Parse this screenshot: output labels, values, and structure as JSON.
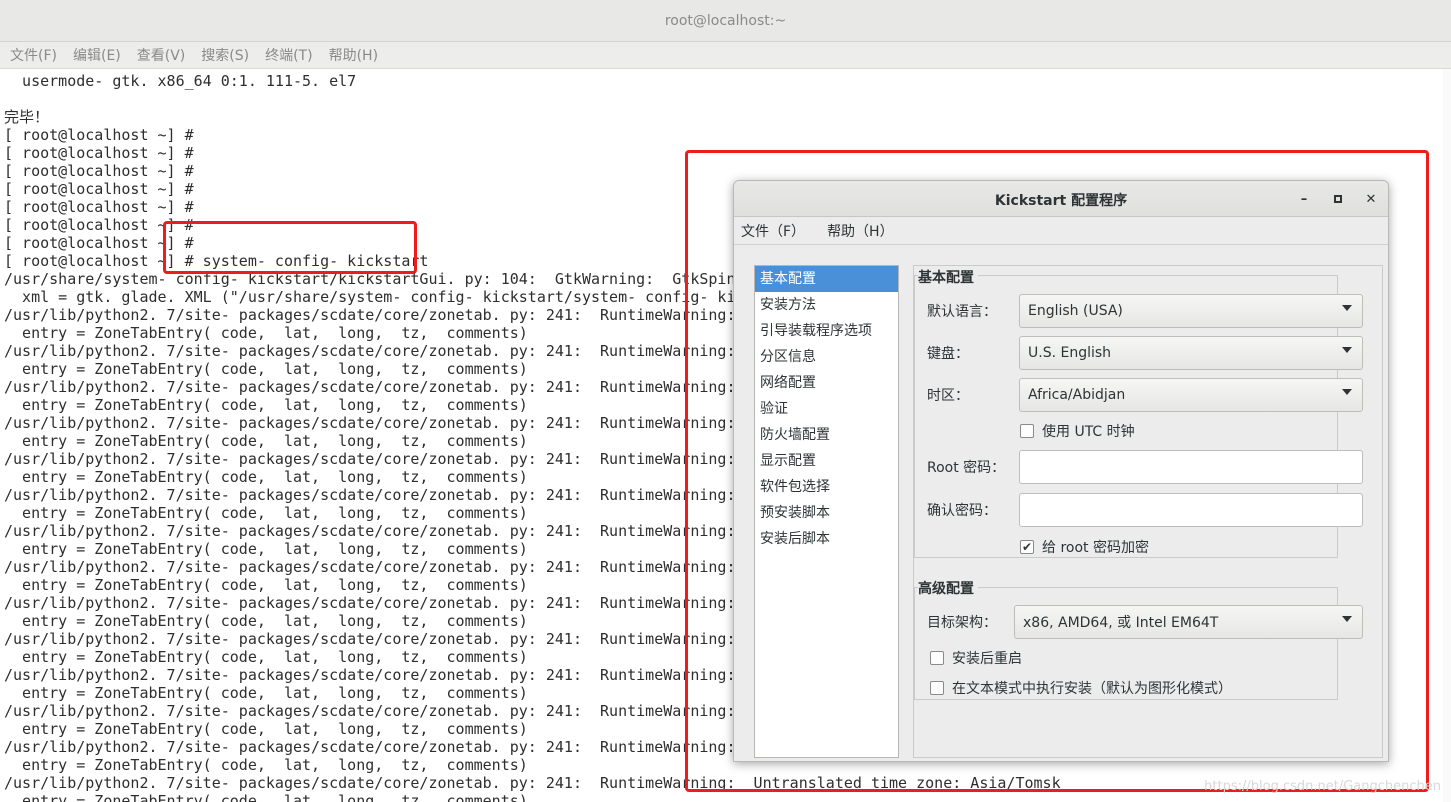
{
  "terminal": {
    "title": "root@localhost:~",
    "menu": [
      "文件(F)",
      "编辑(E)",
      "查看(V)",
      "搜索(S)",
      "终端(T)",
      "帮助(H)"
    ],
    "lines": [
      "  usermode- gtk. x86_64 0:1. 111-5. el7",
      "",
      "完毕！",
      "[ root@localhost ~] #",
      "[ root@localhost ~] #",
      "[ root@localhost ~] #",
      "[ root@localhost ~] #",
      "[ root@localhost ~] #",
      "[ root@localhost ~] #",
      "[ root@localhost ~] #",
      "[ root@localhost ~] # system- config- kickstart",
      "/usr/share/system- config- kickstart/kickstartGui. py: 104:  GtkWarning:  GtkSpinButton",
      "  xml = gtk. glade. XML (\"/usr/share/system- config- kickstart/system- config- kickstar",
      "/usr/lib/python2. 7/site- packages/scdate/core/zonetab. py: 241:  RuntimeWarning:  Untr",
      "  entry = ZoneTabEntry( code,  lat,  long,  tz,  comments)",
      "/usr/lib/python2. 7/site- packages/scdate/core/zonetab. py: 241:  RuntimeWarning:  Untr",
      "  entry = ZoneTabEntry( code,  lat,  long,  tz,  comments)",
      "/usr/lib/python2. 7/site- packages/scdate/core/zonetab. py: 241:  RuntimeWarning:  Untr",
      "  entry = ZoneTabEntry( code,  lat,  long,  tz,  comments)",
      "/usr/lib/python2. 7/site- packages/scdate/core/zonetab. py: 241:  RuntimeWarning:  Untr",
      "  entry = ZoneTabEntry( code,  lat,  long,  tz,  comments)",
      "/usr/lib/python2. 7/site- packages/scdate/core/zonetab. py: 241:  RuntimeWarning:  Untr",
      "  entry = ZoneTabEntry( code,  lat,  long,  tz,  comments)",
      "/usr/lib/python2. 7/site- packages/scdate/core/zonetab. py: 241:  RuntimeWarning:  Untr",
      "  entry = ZoneTabEntry( code,  lat,  long,  tz,  comments)",
      "/usr/lib/python2. 7/site- packages/scdate/core/zonetab. py: 241:  RuntimeWarning:  Untr",
      "  entry = ZoneTabEntry( code,  lat,  long,  tz,  comments)",
      "/usr/lib/python2. 7/site- packages/scdate/core/zonetab. py: 241:  RuntimeWarning:  Untr",
      "  entry = ZoneTabEntry( code,  lat,  long,  tz,  comments)",
      "/usr/lib/python2. 7/site- packages/scdate/core/zonetab. py: 241:  RuntimeWarning:  Untr",
      "  entry = ZoneTabEntry( code,  lat,  long,  tz,  comments)",
      "/usr/lib/python2. 7/site- packages/scdate/core/zonetab. py: 241:  RuntimeWarning:  Untr",
      "  entry = ZoneTabEntry( code,  lat,  long,  tz,  comments)",
      "/usr/lib/python2. 7/site- packages/scdate/core/zonetab. py: 241:  RuntimeWarning:  Untr",
      "  entry = ZoneTabEntry( code,  lat,  long,  tz,  comments)",
      "/usr/lib/python2. 7/site- packages/scdate/core/zonetab. py: 241:  RuntimeWarning:  Untr",
      "  entry = ZoneTabEntry( code,  lat,  long,  tz,  comments)",
      "/usr/lib/python2. 7/site- packages/scdate/core/zonetab. py: 241:  RuntimeWarning:  Untr",
      "  entry = ZoneTabEntry( code,  lat,  long,  tz,  comments)",
      "/usr/lib/python2. 7/site- packages/scdate/core/zonetab. py: 241:  RuntimeWarning:  Untranslated time zone: Asia/Tomsk",
      "  entry = ZoneTabEntry( code,  lat,  long,  tz,  comments)"
    ]
  },
  "dialog": {
    "title": "Kickstart 配置程序",
    "menu": [
      "文件（F）",
      "帮助（H）"
    ],
    "nav_items": [
      "基本配置",
      "安装方法",
      "引导装载程序选项",
      "分区信息",
      "网络配置",
      "验证",
      "防火墙配置",
      "显示配置",
      "软件包选择",
      "预安装脚本",
      "安装后脚本"
    ],
    "basic": {
      "section_title": "基本配置",
      "language_label": "默认语言：",
      "language_value": "English (USA)",
      "keyboard_label": "键盘：",
      "keyboard_value": "U.S. English",
      "timezone_label": "时区：",
      "timezone_value": "Africa/Abidjan",
      "utc_label": "使用  UTC 时钟",
      "utc_checked": false,
      "root_pw_label": "Root 密码：",
      "root_pw_value": "",
      "confirm_pw_label": "确认密码：",
      "confirm_pw_value": "",
      "encrypt_label": "给  root 密码加密",
      "encrypt_checked": true
    },
    "advanced": {
      "section_title": "高级配置",
      "arch_label": "目标架构：",
      "arch_value": "x86, AMD64, 或  Intel EM64T",
      "reboot_label": "安装后重启",
      "reboot_checked": false,
      "textmode_label": "在文本模式中执行安装（默认为图形化模式）",
      "textmode_checked": false
    }
  },
  "watermark": "https://blog.csdn.net/Gangchenchen",
  "colors": {
    "highlight": "#ee1c1c",
    "selection": "#4a90d9"
  }
}
